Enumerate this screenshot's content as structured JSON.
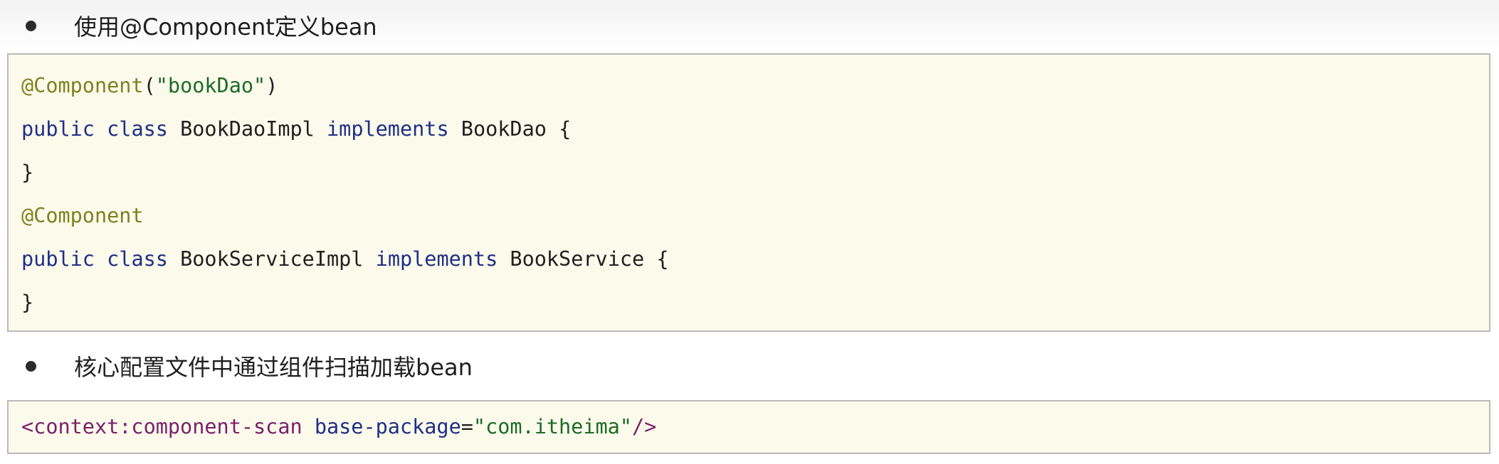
{
  "section1": {
    "title": "使用@Component定义bean",
    "code": {
      "line1": {
        "annotation": "@Component",
        "open_paren": "(",
        "string": "\"bookDao\"",
        "close_paren": ")"
      },
      "line2": {
        "kw_public": "public",
        "kw_class": "class",
        "class_name": "BookDaoImpl",
        "kw_implements": "implements",
        "interface_name": "BookDao",
        "brace": "{"
      },
      "line3": {
        "brace": "}"
      },
      "line4": {
        "annotation": "@Component"
      },
      "line5": {
        "kw_public": "public",
        "kw_class": "class",
        "class_name": "BookServiceImpl",
        "kw_implements": "implements",
        "interface_name": "BookService",
        "brace": "{"
      },
      "line6": {
        "brace": "}"
      }
    }
  },
  "section2": {
    "title": "核心配置文件中通过组件扫描加载bean",
    "code": {
      "tag_open": "<context:component-scan",
      "attr_name": "base-package",
      "equals": "=",
      "attr_value": "\"com.itheima\"",
      "tag_close": "/>"
    }
  },
  "colors": {
    "code_background": "#fcfaeb",
    "code_border": "#b9b9b9",
    "annotation": "#808020",
    "string": "#1b6b27",
    "keyword": "#1e2f86",
    "xml_tag": "#7a1f6b",
    "text": "#1f1f1f"
  }
}
